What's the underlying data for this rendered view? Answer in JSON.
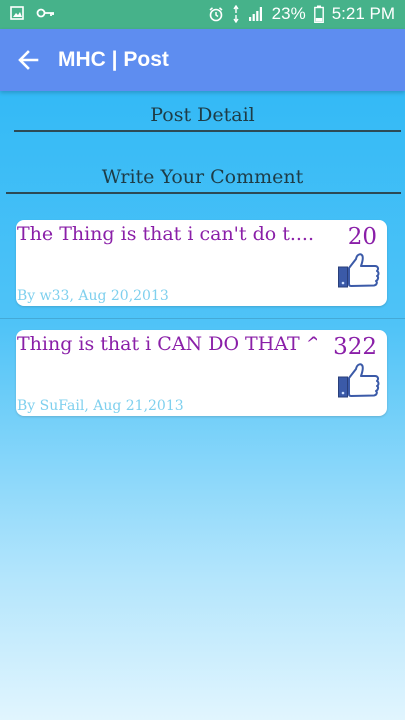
{
  "status_bar": {
    "battery": "23%",
    "time": "5:21 PM",
    "icons": [
      "gallery-icon",
      "key-icon",
      "alarm-icon",
      "data-icon",
      "signal-icon",
      "battery-icon"
    ]
  },
  "app_bar": {
    "title": "MHC | Post",
    "back_icon": "arrow-left-icon"
  },
  "sections": {
    "post_detail": "Post Detail",
    "write_comment": "Write Your Comment"
  },
  "comments": [
    {
      "text": "The Thing is that i can't do t....",
      "meta": "By w33, Aug 20,2013",
      "likes": "20"
    },
    {
      "text": "Thing is that i CAN DO THAT ^",
      "meta": "By SuFail, Aug 21,2013",
      "likes": "322"
    }
  ],
  "colors": {
    "status_bar": "#46b28a",
    "app_bar": "#5e8df0",
    "comment_text": "#8a1fa8",
    "meta_text": "#7fd0ee"
  }
}
